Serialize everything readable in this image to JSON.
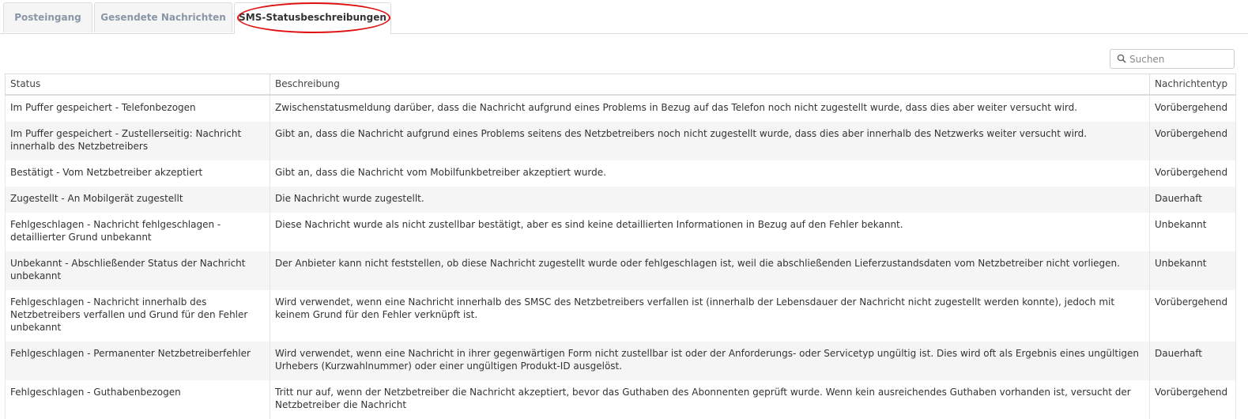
{
  "tabs": [
    {
      "label": "Posteingang"
    },
    {
      "label": "Gesendete Nachrichten"
    },
    {
      "label": "SMS-Statusbeschreibungen"
    }
  ],
  "search": {
    "placeholder": "Suchen",
    "value": ""
  },
  "table": {
    "columns": [
      "Status",
      "Beschreibung",
      "Nachrichtentyp"
    ],
    "rows": [
      {
        "status": "Im Puffer gespeichert - Telefonbezogen",
        "description": "Zwischenstatusmeldung darüber, dass die Nachricht aufgrund eines Problems in Bezug auf das Telefon noch nicht zugestellt wurde, dass dies aber weiter versucht wird.",
        "type": "Vorübergehend"
      },
      {
        "status": "Im Puffer gespeichert - Zustellerseitig: Nachricht innerhalb des Netzbetreibers",
        "description": "Gibt an, dass die Nachricht aufgrund eines Problems seitens des Netzbetreibers noch nicht zugestellt wurde, dass dies aber innerhalb des Netzwerks weiter versucht wird.",
        "type": "Vorübergehend"
      },
      {
        "status": "Bestätigt - Vom Netzbetreiber akzeptiert",
        "description": "Gibt an, dass die Nachricht vom Mobilfunkbetreiber akzeptiert wurde.",
        "type": "Vorübergehend"
      },
      {
        "status": "Zugestellt - An Mobilgerät zugestellt",
        "description": "Die Nachricht wurde zugestellt.",
        "type": "Dauerhaft"
      },
      {
        "status": "Fehlgeschlagen - Nachricht fehlgeschlagen - detaillierter Grund unbekannt",
        "description": "Diese Nachricht wurde als nicht zustellbar bestätigt, aber es sind keine detaillierten Informationen in Bezug auf den Fehler bekannt.",
        "type": "Unbekannt"
      },
      {
        "status": "Unbekannt - Abschließender Status der Nachricht unbekannt",
        "description": "Der Anbieter kann nicht feststellen, ob diese Nachricht zugestellt wurde oder fehlgeschlagen ist, weil die abschließenden Lieferzustandsdaten vom Netzbetreiber nicht vorliegen.",
        "type": "Unbekannt"
      },
      {
        "status": "Fehlgeschlagen - Nachricht innerhalb des Netzbetreibers verfallen und Grund für den Fehler unbekannt",
        "description": "Wird verwendet, wenn eine Nachricht innerhalb des SMSC des Netzbetreibers verfallen ist (innerhalb der Lebensdauer der Nachricht nicht zugestellt werden konnte), jedoch mit keinem Grund für den Fehler verknüpft ist.",
        "type": "Vorübergehend"
      },
      {
        "status": "Fehlgeschlagen - Permanenter Netzbetreiberfehler",
        "description": "Wird verwendet, wenn eine Nachricht in ihrer gegenwärtigen Form nicht zustellbar ist oder der Anforderungs- oder Servicetyp ungültig ist. Dies wird oft als Ergebnis eines ungültigen Urhebers (Kurzwahlnummer) oder einer ungültigen Produkt-ID ausgelöst.",
        "type": "Dauerhaft"
      },
      {
        "status": "Fehlgeschlagen - Guthabenbezogen",
        "description": "Tritt nur auf, wenn der Netzbetreiber die Nachricht akzeptiert, bevor das Guthaben des Abonnenten geprüft wurde. Wenn kein ausreichendes Guthaben vorhanden ist, versucht der Netzbetreiber die Nachricht",
        "type": "Vorübergehend"
      }
    ]
  }
}
